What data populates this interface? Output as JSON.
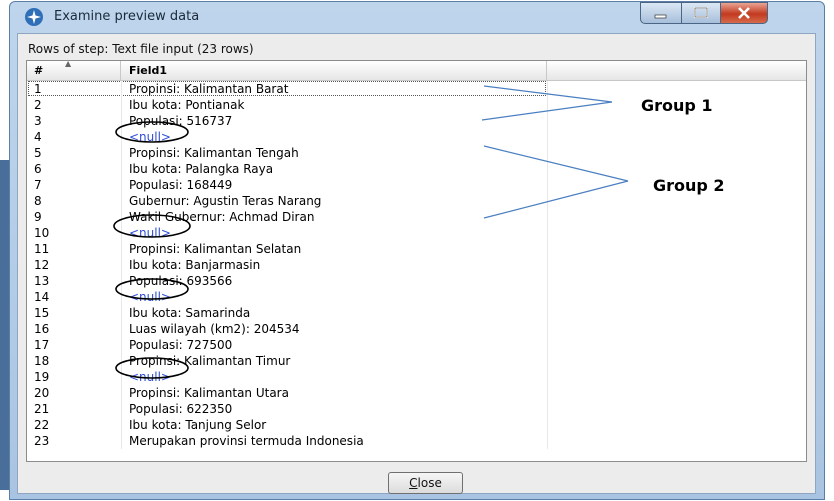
{
  "window": {
    "title": "Examine preview data",
    "icon": "kettle-spoon-icon",
    "controls": [
      "minimize-icon",
      "maximize-icon",
      "close-icon"
    ]
  },
  "caption": "Rows of step: Text file input (23 rows)",
  "table": {
    "columns": [
      "#",
      "Field1"
    ],
    "rows": [
      {
        "num": "1",
        "value": "Propinsi: Kalimantan Barat"
      },
      {
        "num": "2",
        "value": "Ibu kota: Pontianak"
      },
      {
        "num": "3",
        "value": "Populasi: 516737"
      },
      {
        "num": "4",
        "value": "<null>"
      },
      {
        "num": "5",
        "value": "Propinsi: Kalimantan Tengah"
      },
      {
        "num": "6",
        "value": "Ibu kota: Palangka Raya"
      },
      {
        "num": "7",
        "value": "Populasi: 168449"
      },
      {
        "num": "8",
        "value": "Gubernur: Agustin Teras Narang"
      },
      {
        "num": "9",
        "value": "Wakil Gubernur: Achmad Diran"
      },
      {
        "num": "10",
        "value": "<null>"
      },
      {
        "num": "11",
        "value": "Propinsi: Kalimantan Selatan"
      },
      {
        "num": "12",
        "value": "Ibu kota: Banjarmasin"
      },
      {
        "num": "13",
        "value": "Populasi: 693566"
      },
      {
        "num": "14",
        "value": "<null>"
      },
      {
        "num": "15",
        "value": "Ibu kota: Samarinda"
      },
      {
        "num": "16",
        "value": "Luas wilayah (km2): 204534"
      },
      {
        "num": "17",
        "value": "Populasi: 727500"
      },
      {
        "num": "18",
        "value": "Propinsi: Kalimantan Timur"
      },
      {
        "num": "19",
        "value": "<null>"
      },
      {
        "num": "20",
        "value": "Propinsi: Kalimantan Utara"
      },
      {
        "num": "21",
        "value": "Populasi: 622350"
      },
      {
        "num": "22",
        "value": "Ibu kota: Tanjung Selor"
      },
      {
        "num": "23",
        "value": "Merupakan provinsi termuda Indonesia"
      }
    ]
  },
  "annotations": {
    "group1_label": "Group 1",
    "group2_label": "Group 2"
  },
  "buttons": {
    "close_label": "Close"
  },
  "colors": {
    "null_text": "#2e4dd4",
    "titlebar": "#bfd5ec",
    "close_control": "#c23a1f"
  }
}
